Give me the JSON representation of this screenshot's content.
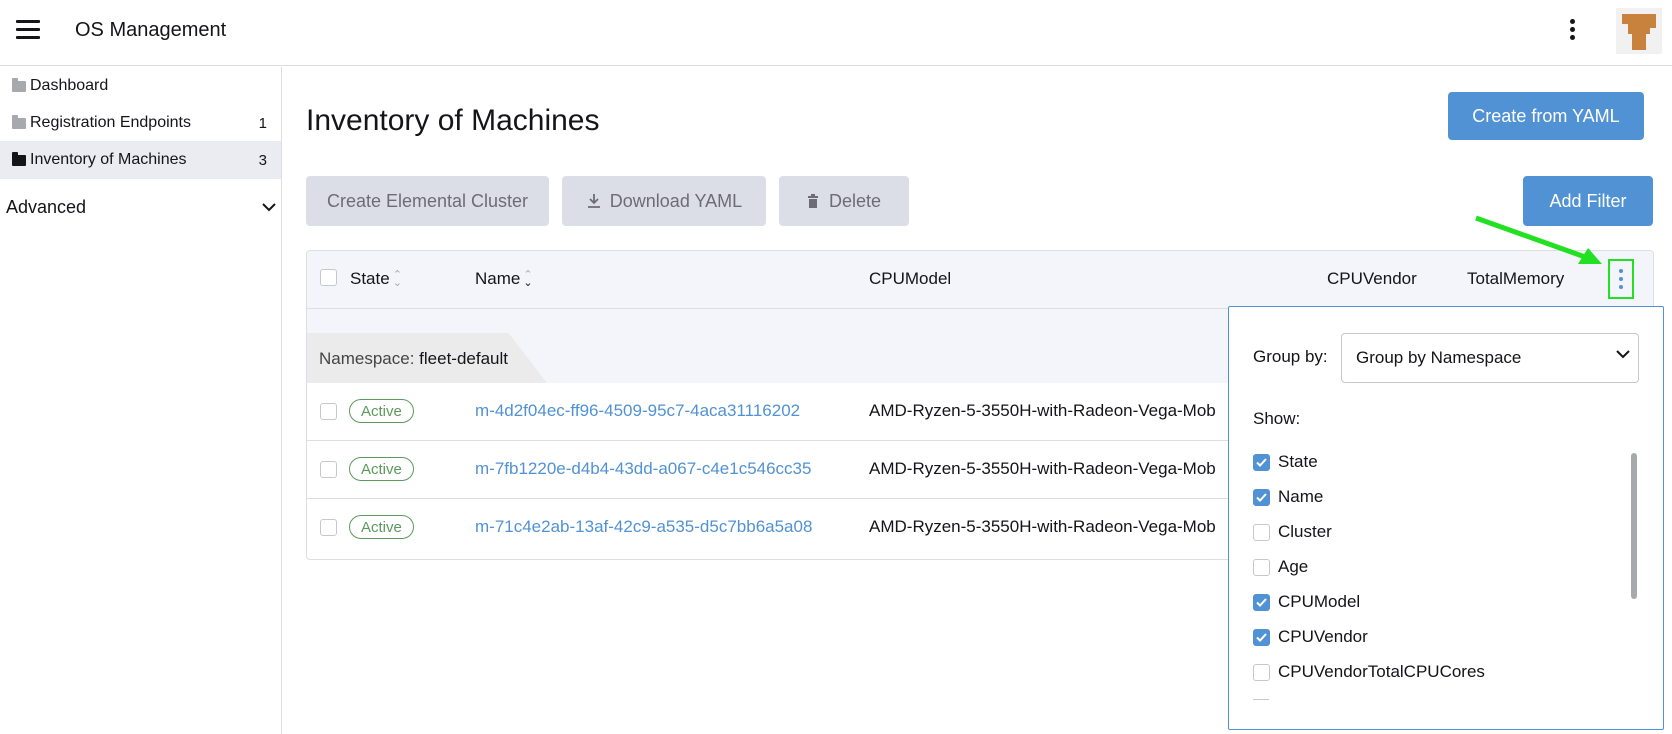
{
  "header": {
    "title": "OS Management"
  },
  "sidebar": {
    "items": [
      {
        "label": "Dashboard",
        "count": ""
      },
      {
        "label": "Registration Endpoints",
        "count": "1"
      },
      {
        "label": "Inventory of Machines",
        "count": "3"
      }
    ],
    "advanced_label": "Advanced"
  },
  "page": {
    "title": "Inventory of Machines",
    "create_button": "Create from YAML",
    "actions": {
      "create_cluster": "Create Elemental Cluster",
      "download": "Download YAML",
      "delete": "Delete",
      "add_filter": "Add Filter"
    }
  },
  "table": {
    "headers": {
      "state": "State",
      "name": "Name",
      "cpu_model": "CPUModel",
      "cpu_vendor": "CPUVendor",
      "total_memory": "TotalMemory"
    },
    "group": {
      "key": "Namespace:",
      "value": "fleet-default"
    },
    "rows": [
      {
        "state": "Active",
        "name": "m-4d2f04ec-ff96-4509-95c7-4aca31116202",
        "cpu": "AMD-Ryzen-5-3550H-with-Radeon-Vega-Mob"
      },
      {
        "state": "Active",
        "name": "m-7fb1220e-d4b4-43dd-a067-c4e1c546cc35",
        "cpu": "AMD-Ryzen-5-3550H-with-Radeon-Vega-Mob"
      },
      {
        "state": "Active",
        "name": "m-71c4e2ab-13af-42c9-a535-d5c7bb6a5a08",
        "cpu": "AMD-Ryzen-5-3550H-with-Radeon-Vega-Mob"
      }
    ]
  },
  "columns_panel": {
    "group_by_label": "Group by:",
    "group_by_value": "Group by Namespace",
    "show_label": "Show:",
    "options": [
      {
        "label": "State",
        "checked": true
      },
      {
        "label": "Name",
        "checked": true
      },
      {
        "label": "Cluster",
        "checked": false
      },
      {
        "label": "Age",
        "checked": false
      },
      {
        "label": "CPUModel",
        "checked": true
      },
      {
        "label": "CPUVendor",
        "checked": true
      },
      {
        "label": "CPUVendorTotalCPUCores",
        "checked": false
      }
    ]
  },
  "colors": {
    "accent": "#5192d4",
    "active": "#5d995d",
    "highlight": "#22e022"
  }
}
